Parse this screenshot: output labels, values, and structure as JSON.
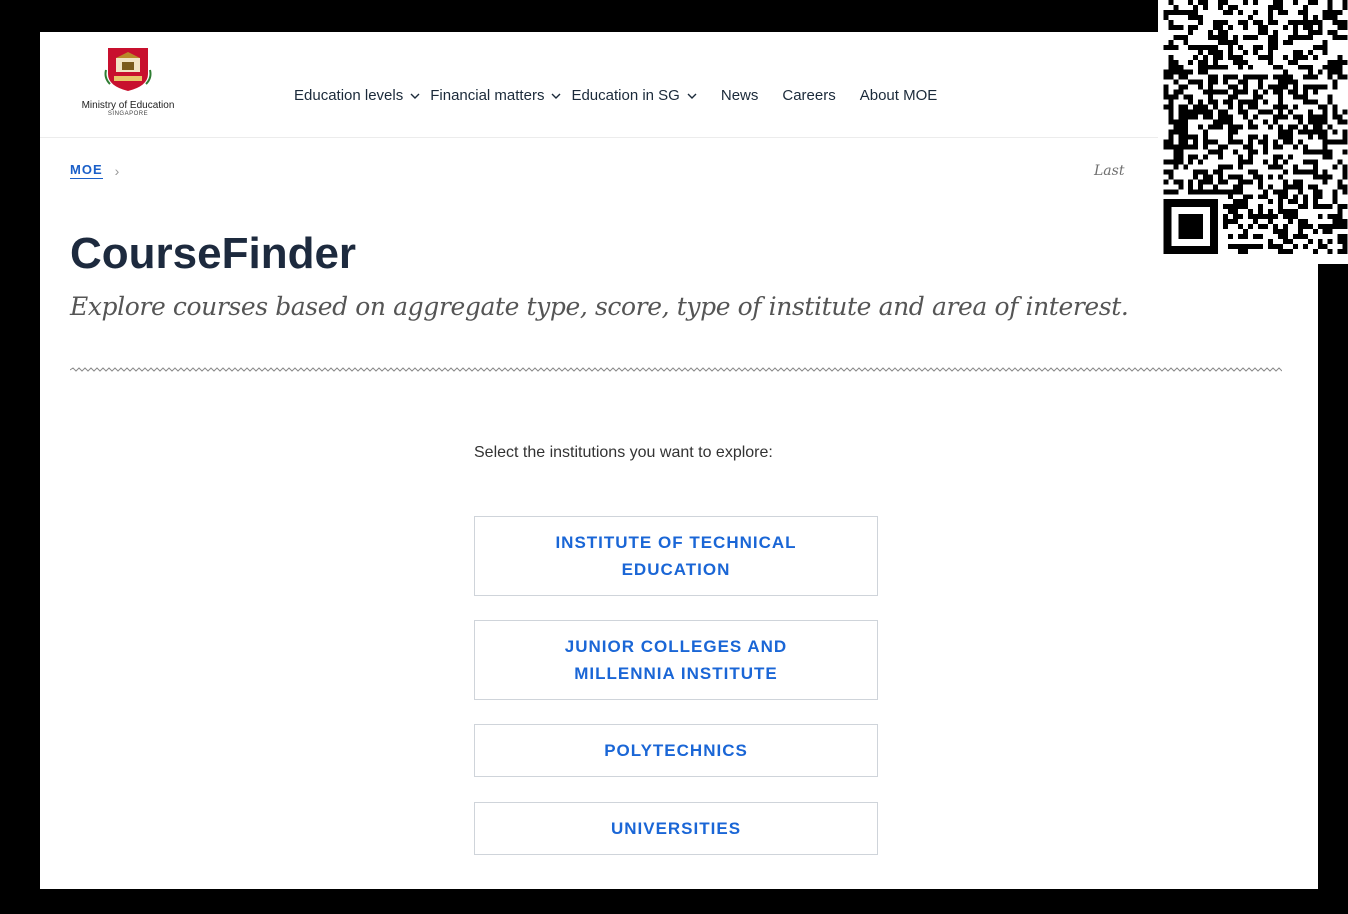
{
  "header": {
    "logo_name": "Ministry of Education",
    "logo_sub": "SINGAPORE",
    "nav": [
      {
        "label": "Education levels",
        "dropdown": true
      },
      {
        "label": "Financial matters",
        "dropdown": true
      },
      {
        "label": "Education in SG",
        "dropdown": true
      },
      {
        "label": "News",
        "dropdown": false
      },
      {
        "label": "Careers",
        "dropdown": false
      },
      {
        "label": "About MOE",
        "dropdown": false
      }
    ]
  },
  "breadcrumb": {
    "root": "MOE"
  },
  "last_updated": "Last",
  "page": {
    "title": "CourseFinder",
    "subtitle": "Explore courses based on aggregate type, score, type of institute and area of interest.",
    "prompt": "Select the institutions you want to explore:"
  },
  "institutions": [
    "INSTITUTE OF TECHNICAL EDUCATION",
    "JUNIOR COLLEGES AND MILLENNIA INSTITUTE",
    "POLYTECHNICS",
    "UNIVERSITIES"
  ],
  "colors": {
    "accent": "#1a66d6",
    "title": "#1d2a3e",
    "crest_red": "#c8102e"
  }
}
